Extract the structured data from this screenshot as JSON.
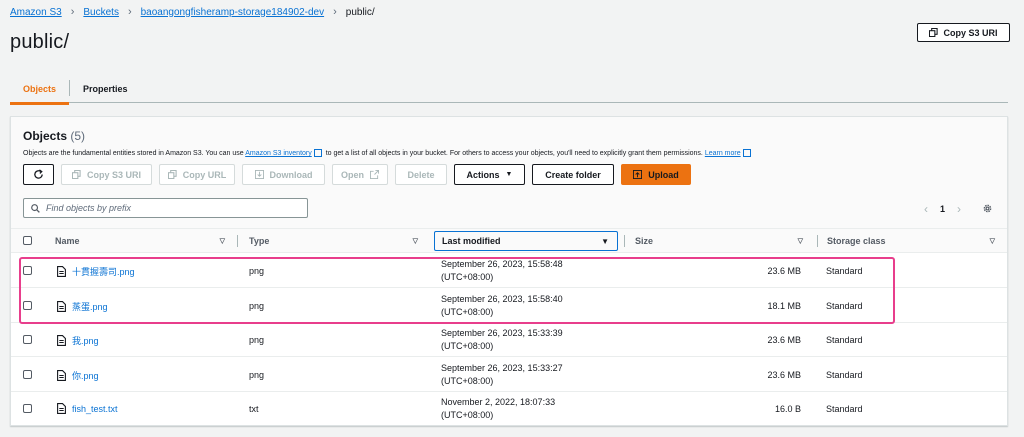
{
  "breadcrumb": {
    "items": [
      "Amazon S3",
      "Buckets",
      "baoangongfisheramp-storage184902-dev"
    ],
    "current": "public/"
  },
  "page_title": "public/",
  "header": {
    "copy_uri_label": "Copy S3 URI"
  },
  "tabs": [
    {
      "label": "Objects"
    },
    {
      "label": "Properties"
    }
  ],
  "objects": {
    "title": "Objects",
    "count": "(5)",
    "desc_pre": "Objects are the fundamental entities stored in Amazon S3. You can use ",
    "desc_link1": "Amazon S3 inventory",
    "desc_mid": " to get a list of all objects in your bucket. For others to access your objects, you'll need to explicitly grant them permissions. ",
    "desc_link2": "Learn more",
    "toolbar": {
      "copy_uri": "Copy S3 URI",
      "copy_url": "Copy URL",
      "download": "Download",
      "open": "Open",
      "delete": "Delete",
      "actions": "Actions",
      "create_folder": "Create folder",
      "upload": "Upload"
    },
    "search_placeholder": "Find objects by prefix",
    "page_number": "1",
    "columns": {
      "name": "Name",
      "type": "Type",
      "last_modified": "Last modified",
      "size": "Size",
      "storage_class": "Storage class"
    },
    "rows": [
      {
        "name": "十貫握壽司.png",
        "type": "png",
        "date": "September 26, 2023, 15:58:48",
        "tz": "(UTC+08:00)",
        "size": "23.6 MB",
        "storage": "Standard"
      },
      {
        "name": "蒸蛋.png",
        "type": "png",
        "date": "September 26, 2023, 15:58:40",
        "tz": "(UTC+08:00)",
        "size": "18.1 MB",
        "storage": "Standard"
      },
      {
        "name": "我.png",
        "type": "png",
        "date": "September 26, 2023, 15:33:39",
        "tz": "(UTC+08:00)",
        "size": "23.6 MB",
        "storage": "Standard"
      },
      {
        "name": "你.png",
        "type": "png",
        "date": "September 26, 2023, 15:33:27",
        "tz": "(UTC+08:00)",
        "size": "23.6 MB",
        "storage": "Standard"
      },
      {
        "name": "fish_test.txt",
        "type": "txt",
        "date": "November 2, 2022, 18:07:33",
        "tz": "(UTC+08:00)",
        "size": "16.0 B",
        "storage": "Standard"
      }
    ]
  },
  "colors": {
    "link": "#0972d3",
    "accent": "#ec7211",
    "highlight": "#e83e8c"
  }
}
